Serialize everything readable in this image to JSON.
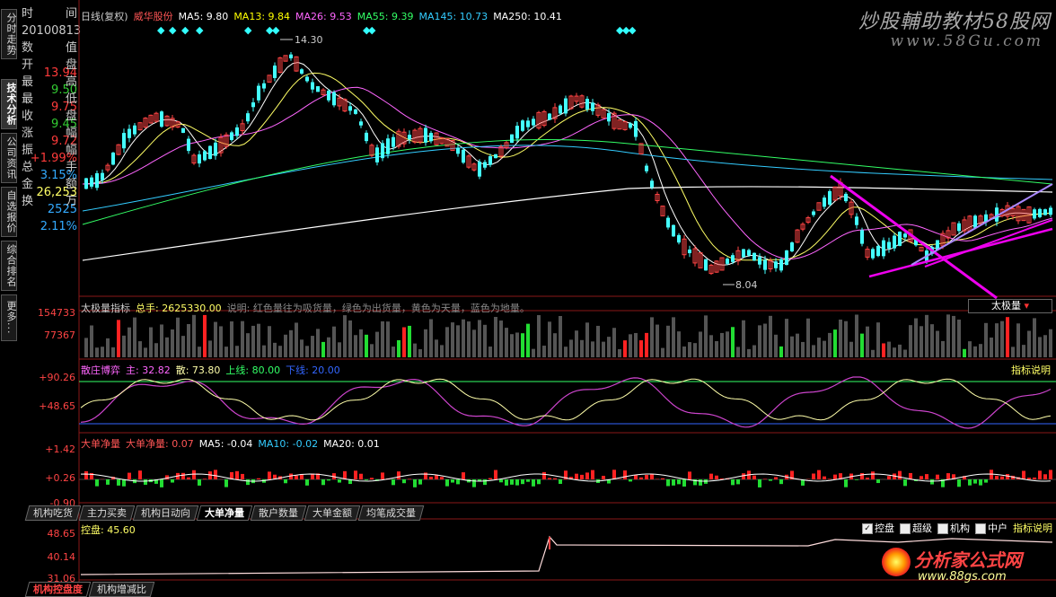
{
  "left_tabs": [
    {
      "label": "分时走势",
      "active": false
    },
    {
      "label": "技术分析",
      "active": true
    },
    {
      "label": "公司资讯",
      "active": false
    },
    {
      "label": "自选报价",
      "active": false
    },
    {
      "label": "综合排名",
      "active": false
    },
    {
      "label": "更多...",
      "active": false
    }
  ],
  "info_panel": [
    {
      "l": "时",
      "r": "间",
      "v": "",
      "color": "#cccccc"
    },
    {
      "l": "20100813",
      "r": "",
      "v": "",
      "color": "#cccccc"
    },
    {
      "l": "数",
      "r": "值",
      "v": "",
      "color": "#cccccc"
    },
    {
      "l": "开",
      "r": "盘",
      "v": "13.94",
      "color": "#ff3b3b"
    },
    {
      "l": "最",
      "r": "高",
      "v": "9.50",
      "color": "#33cc33"
    },
    {
      "l": "最",
      "r": "低",
      "v": "9.75",
      "color": "#ff3b3b"
    },
    {
      "l": "收",
      "r": "盘",
      "v": "9.45",
      "color": "#33cc33"
    },
    {
      "l": "涨",
      "r": "幅",
      "v": "9.72",
      "color": "#ff3b3b"
    },
    {
      "l": "振",
      "r": "幅",
      "v": "+1.99%",
      "color": "#ff3b3b"
    },
    {
      "l": "总",
      "r": "手",
      "v": "3.15%",
      "color": "#33aaff"
    },
    {
      "l": "金",
      "r": "额",
      "v": "26,253",
      "color": "#ffff66"
    },
    {
      "l": "换",
      "r": "万",
      "v": "2525",
      "color": "#33aaff"
    },
    {
      "l": "",
      "r": "",
      "v": "2.11%",
      "color": "#33aaff"
    }
  ],
  "title_bar": [
    {
      "text": "日线(复权)",
      "color": "#cccccc"
    },
    {
      "text": "威华股份",
      "color": "#ff5555"
    },
    {
      "text": "MA5: 9.80",
      "color": "#ffffff"
    },
    {
      "text": "MA13: 9.84",
      "color": "#ffff00"
    },
    {
      "text": "MA26: 9.53",
      "color": "#ff66ff"
    },
    {
      "text": "MA55: 9.39",
      "color": "#33ff66"
    },
    {
      "text": "MA145: 10.73",
      "color": "#33ccff"
    },
    {
      "text": "MA250: 10.41",
      "color": "#ffffff"
    }
  ],
  "watermark_top": "炒股輔助教材58股网",
  "watermark_url": "www.58Gu.com",
  "watermark_bottom": "分析家公式网",
  "watermark_bottom_url": "www.88gs.com",
  "price_annotations": {
    "high": "14.30",
    "low": "8.04"
  },
  "volume_panel": {
    "header": [
      {
        "text": "太极量指标",
        "color": "#cccccc"
      },
      {
        "text": "总手: 2625330.00",
        "color": "#ffff66"
      },
      {
        "text": "说明: 红色量往为吸货量，绿色为出货量，黄色为天量，蓝色为地量。",
        "color": "#888888"
      }
    ],
    "yticks": [
      "154733",
      "77367"
    ],
    "selector": "太极量"
  },
  "osc_panel": {
    "header": [
      {
        "text": "散庄博弈",
        "color": "#ff66ff"
      },
      {
        "text": "主: 32.82",
        "color": "#ff66ff"
      },
      {
        "text": "散: 73.80",
        "color": "#ffffaa"
      },
      {
        "text": "上线: 80.00",
        "color": "#33ff66"
      },
      {
        "text": "下线: 20.00",
        "color": "#3366ff"
      }
    ],
    "yticks": [
      "+90.26",
      "+48.65"
    ],
    "help": "指标说明"
  },
  "net_panel": {
    "header": [
      {
        "text": "大单净量",
        "color": "#ff5555"
      },
      {
        "text": "大单净量: 0.07",
        "color": "#ff5555"
      },
      {
        "text": "MA5: -0.04",
        "color": "#ffffff"
      },
      {
        "text": "MA10: -0.02",
        "color": "#33ccff"
      },
      {
        "text": "MA20: 0.01",
        "color": "#ffffff"
      }
    ],
    "yticks": [
      "+1.42",
      "+0.26",
      "-0.90"
    ]
  },
  "bottom_tabs": [
    {
      "label": "机构吃货",
      "active": false
    },
    {
      "label": "主力买卖",
      "active": false
    },
    {
      "label": "机构日动向",
      "active": false
    },
    {
      "label": "大单净量",
      "active": true
    },
    {
      "label": "散户数量",
      "active": false
    },
    {
      "label": "大单金额",
      "active": false
    },
    {
      "label": "均笔成交量",
      "active": false
    }
  ],
  "control_panel": {
    "header": "控盘: 45.60",
    "yticks": [
      "48.65",
      "40.14",
      "31.06"
    ],
    "checkboxes": [
      {
        "label": "控盘",
        "checked": true
      },
      {
        "label": "超级",
        "checked": false
      },
      {
        "label": "机构",
        "checked": false
      },
      {
        "label": "中户",
        "checked": false
      }
    ],
    "help": "指标说明"
  },
  "footer_tabs": [
    {
      "label": "机构控盘度",
      "active": true
    },
    {
      "label": "机构增减比",
      "active": false
    }
  ],
  "colors": {
    "up": "#ff3333",
    "down": "#33ffff",
    "green": "#00dd33",
    "magenta": "#ee00ee",
    "grid": "#7a1a1a"
  }
}
